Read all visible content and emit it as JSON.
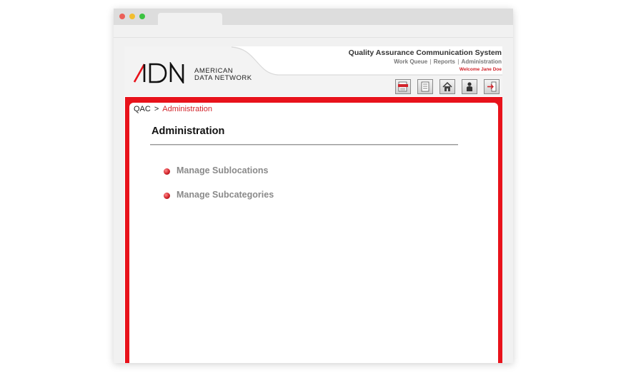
{
  "app": {
    "system_title": "Quality Assurance Communication System",
    "logo": {
      "mark": "ADN",
      "line1": "AMERICAN",
      "line2": "DATA NETWORK"
    },
    "nav": [
      {
        "label": "Work Queue"
      },
      {
        "label": "Reports"
      },
      {
        "label": "Administration"
      }
    ],
    "nav_separator": "|",
    "welcome": "Welcome Jane Doe",
    "toolbar_icons": [
      "xml-report-icon",
      "document-icon",
      "home-icon",
      "user-icon",
      "logout-icon"
    ]
  },
  "breadcrumb": {
    "root": "QAC",
    "separator": ">",
    "current": "Administration"
  },
  "main": {
    "title": "Administration",
    "links": [
      {
        "label": "Manage Sublocations"
      },
      {
        "label": "Manage Subcategories"
      }
    ]
  },
  "colors": {
    "accent": "#e8121b",
    "text_accent": "#d2232a",
    "link": "#8a8a8a"
  }
}
